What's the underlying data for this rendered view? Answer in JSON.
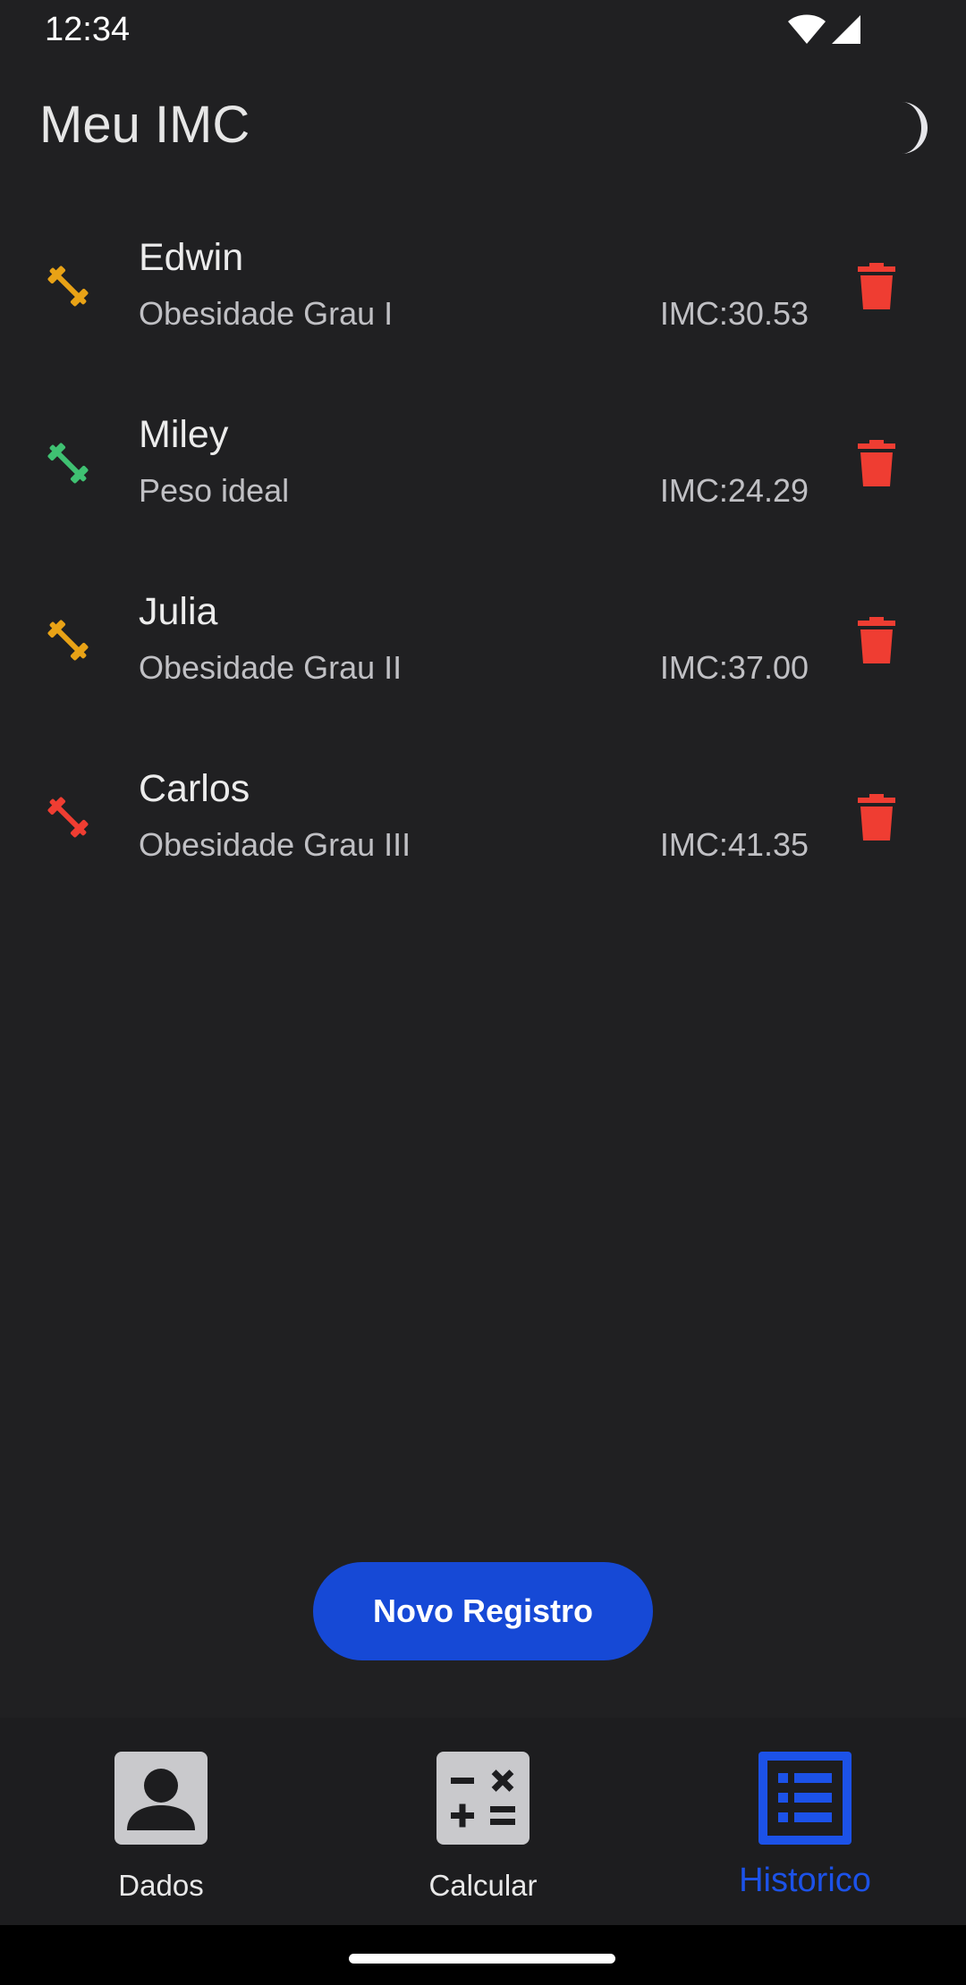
{
  "status_bar": {
    "time": "12:34"
  },
  "app_bar": {
    "title": "Meu IMC",
    "theme_icon": "moon-icon"
  },
  "records": [
    {
      "name": "Edwin",
      "category": "Obesidade Grau I",
      "imc": "IMC:30.53",
      "color": "#e8a216"
    },
    {
      "name": "Miley",
      "category": "Peso ideal",
      "imc": "IMC:24.29",
      "color": "#3fc172"
    },
    {
      "name": "Julia",
      "category": "Obesidade Grau II",
      "imc": "IMC:37.00",
      "color": "#e8a216"
    },
    {
      "name": "Carlos",
      "category": "Obesidade Grau III",
      "imc": "IMC:41.35",
      "color": "#ef3d32"
    }
  ],
  "delete_color": "#ef3d32",
  "new_record_button": "Novo Registro",
  "bottom_nav": {
    "items": [
      {
        "label": "Dados",
        "icon": "person-icon",
        "active": false
      },
      {
        "label": "Calcular",
        "icon": "calculator-icon",
        "active": false
      },
      {
        "label": "Historico",
        "icon": "list-icon",
        "active": true
      }
    ],
    "active_color": "#1c52e8",
    "inactive_color": "#c9c9cc"
  }
}
